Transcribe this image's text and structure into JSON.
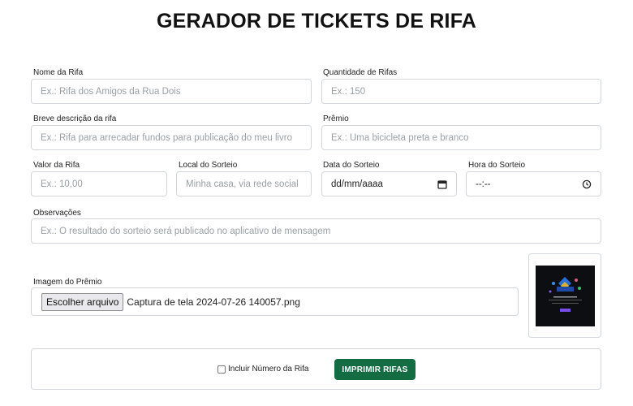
{
  "title": "GERADOR DE TICKETS DE RIFA",
  "form": {
    "nome": {
      "label": "Nome da Rifa",
      "placeholder": "Ex.: Rifa dos Amigos da Rua Dois"
    },
    "quantidade": {
      "label": "Quantidade de Rifas",
      "placeholder": "Ex.: 150"
    },
    "descricao": {
      "label": "Breve descrição da rifa",
      "placeholder": "Ex.: Rifa para arrecadar fundos para publicação do meu livro"
    },
    "premio": {
      "label": "Prêmio",
      "placeholder": "Ex.: Uma bicicleta preta e branco"
    },
    "valor": {
      "label": "Valor da Rifa",
      "placeholder": "Ex.: 10,00"
    },
    "local": {
      "label": "Local do Sorteio",
      "placeholder": "Minha casa, via rede social"
    },
    "data": {
      "label": "Data do Sorteio",
      "value": "dd/mm/aaaa",
      "icon": "calendar-icon"
    },
    "hora": {
      "label": "Hora do Sorteio",
      "value": "--:--",
      "icon": "clock-icon"
    },
    "observacoes": {
      "label": "Observações",
      "placeholder": "Ex.: O resultado do sorteio será publicado no aplicativo de mensagem"
    },
    "imagem": {
      "label": "Imagem do Prêmio",
      "button": "Escolher arquivo",
      "filename": "Captura de tela 2024-07-26 140057.png"
    }
  },
  "footer": {
    "checkbox_label": "Incluir Número da Rifa",
    "checkbox_checked": false,
    "print_button": "IMPRIMIR RIFAS",
    "print_color": "#146c43"
  }
}
